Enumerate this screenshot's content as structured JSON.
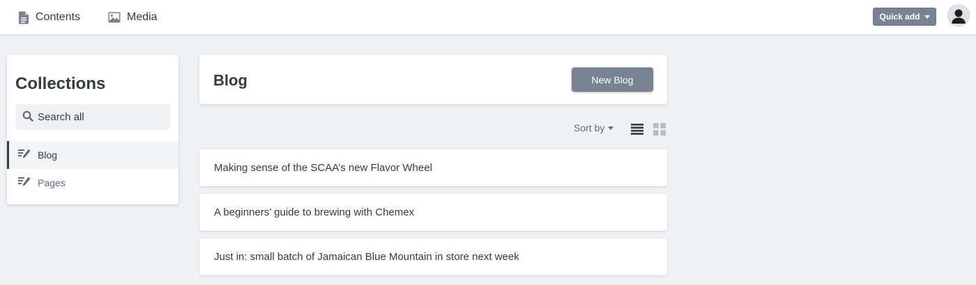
{
  "topbar": {
    "contents_label": "Contents",
    "contents_icon": "document-icon",
    "media_label": "Media",
    "media_icon": "image-icon",
    "quick_add_label": "Quick add",
    "avatar_icon": "user-avatar-icon"
  },
  "sidebar": {
    "title": "Collections",
    "search_placeholder": "Search all",
    "items": [
      {
        "label": "Blog",
        "icon": "edit-list-icon",
        "active": true
      },
      {
        "label": "Pages",
        "icon": "edit-list-icon",
        "active": false
      }
    ]
  },
  "main": {
    "title": "Blog",
    "new_button_label": "New Blog",
    "sort_label": "Sort by",
    "view_modes": [
      "list-view-icon",
      "grid-view-icon"
    ],
    "active_view": "list",
    "entries": [
      {
        "title": "Making sense of the SCAA’s new Flavor Wheel"
      },
      {
        "title": "A beginners’ guide to brewing with Chemex"
      },
      {
        "title": "Just in: small batch of Jamaican Blue Mountain in store next week"
      }
    ]
  },
  "colors": {
    "background": "#eff1f4",
    "button": "#798291",
    "text": "#313d3e",
    "muted_text": "#5f6a78"
  }
}
